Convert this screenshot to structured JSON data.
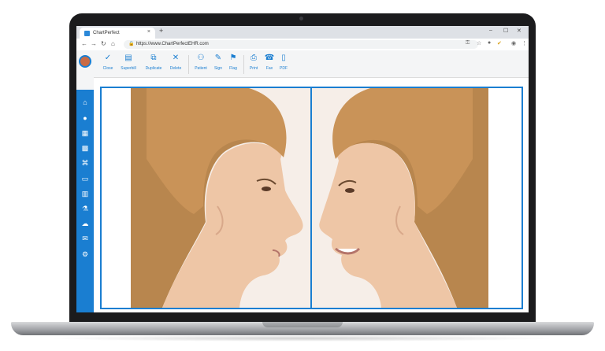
{
  "browser": {
    "tab_title": "ChartPerfect",
    "tab_close": "×",
    "new_tab": "+",
    "url": "https://www.ChartPerfectEHR.com",
    "win_min": "–",
    "win_max": "☐",
    "win_close": "✕"
  },
  "toolbar": {
    "close_label": "Close",
    "superbill_label": "Superbill",
    "duplicate_label": "Duplicate",
    "delete_label": "Delete",
    "patient_label": "Patient",
    "sign_label": "Sign",
    "flag_label": "Flag",
    "print_label": "Print",
    "fax_label": "Fax",
    "pdf_label": "PDF"
  },
  "sidebar": {
    "items": [
      "home-icon",
      "user-icon",
      "calendar-icon",
      "grid-icon",
      "chart-icon",
      "id-card-icon",
      "building-icon",
      "lab-flask-icon",
      "cloud-icon",
      "chat-icon",
      "settings-icon"
    ]
  },
  "colors": {
    "accent": "#1a7ed1",
    "chrome": "#dee1e6",
    "laptop": "#1b1b1d"
  },
  "images": {
    "left": "Before photo — woman profile facing right",
    "right": "After photo — woman profile facing left, smiling"
  }
}
